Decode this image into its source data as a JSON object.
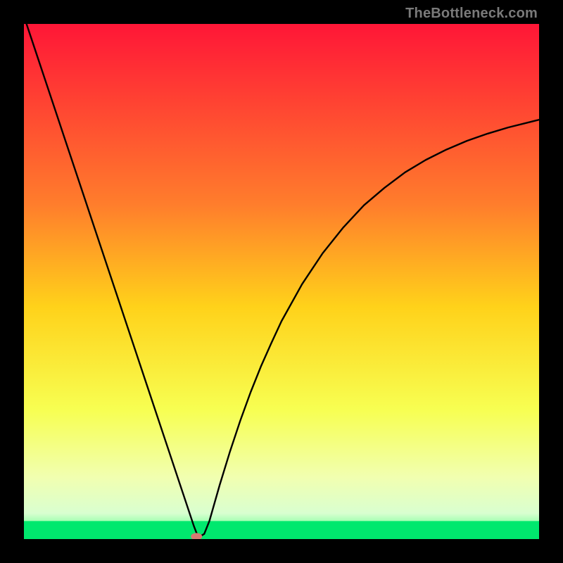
{
  "watermark": "TheBottleneck.com",
  "chart_data": {
    "type": "line",
    "title": "",
    "xlabel": "",
    "ylabel": "",
    "xlim": [
      0,
      100
    ],
    "ylim": [
      0,
      100
    ],
    "grid": false,
    "legend": false,
    "series": [
      {
        "name": "curve",
        "x": [
          0.5,
          2,
          4,
          6,
          8,
          10,
          12,
          14,
          16,
          18,
          20,
          22,
          24,
          26,
          28,
          29,
          30,
          31,
          32,
          32.5,
          33,
          33.5,
          34,
          35,
          36,
          37,
          38,
          40,
          42,
          44,
          46,
          48,
          50,
          54,
          58,
          62,
          66,
          70,
          74,
          78,
          82,
          86,
          90,
          94,
          98,
          100
        ],
        "y": [
          100,
          95.5,
          89.5,
          83.5,
          77.5,
          71.5,
          65.5,
          59.5,
          53.5,
          47.5,
          41.5,
          35.5,
          29.5,
          23.5,
          17.5,
          14.5,
          11.5,
          8.5,
          5.5,
          4.0,
          2.5,
          1.2,
          0.4,
          1.0,
          3.5,
          7.0,
          10.5,
          17.0,
          23.0,
          28.5,
          33.5,
          38.0,
          42.3,
          49.5,
          55.5,
          60.5,
          64.8,
          68.2,
          71.2,
          73.6,
          75.6,
          77.3,
          78.7,
          79.9,
          80.9,
          81.4
        ]
      }
    ],
    "marker": {
      "x": 33.5,
      "y": 0.5,
      "color": "#d77a72",
      "rx": 8,
      "ry": 5
    },
    "green_band": {
      "y0": 0,
      "y1": 3.5
    },
    "gradient_stops": [
      {
        "offset": 0,
        "color": "#ff1637"
      },
      {
        "offset": 35,
        "color": "#ff7d2c"
      },
      {
        "offset": 55,
        "color": "#ffd21a"
      },
      {
        "offset": 75,
        "color": "#f7ff52"
      },
      {
        "offset": 88,
        "color": "#f1ffb0"
      },
      {
        "offset": 95,
        "color": "#d9ffd0"
      },
      {
        "offset": 99,
        "color": "#53ff86"
      },
      {
        "offset": 100,
        "color": "#00e86e"
      }
    ]
  }
}
